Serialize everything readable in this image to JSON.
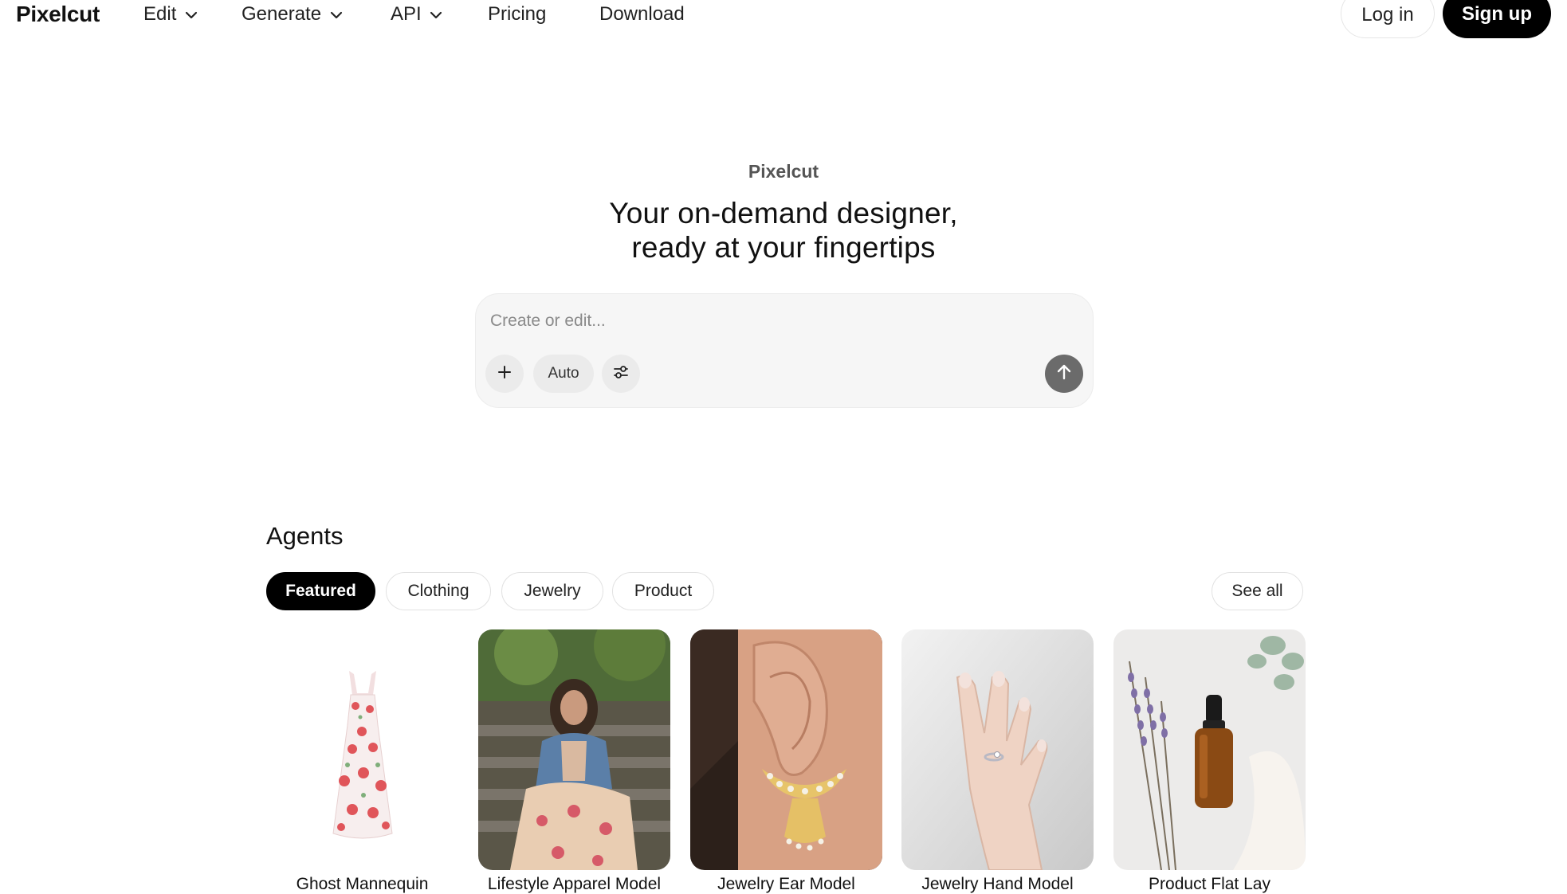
{
  "nav": {
    "logo": "Pixelcut",
    "items": [
      {
        "label": "Edit",
        "has_dropdown": true
      },
      {
        "label": "Generate",
        "has_dropdown": true
      },
      {
        "label": "API",
        "has_dropdown": true
      },
      {
        "label": "Pricing",
        "has_dropdown": false
      },
      {
        "label": "Download",
        "has_dropdown": false
      }
    ],
    "login_label": "Log in",
    "signup_label": "Sign up"
  },
  "hero": {
    "kicker": "Pixelcut",
    "title_line1": "Your on-demand designer,",
    "title_line2": "ready at your fingertips"
  },
  "prompt": {
    "placeholder": "Create or edit...",
    "value": "",
    "mode_label": "Auto",
    "icons": [
      "plus-icon",
      "sliders-icon",
      "arrow-up-icon"
    ]
  },
  "agents": {
    "title": "Agents",
    "filters": [
      {
        "label": "Featured",
        "active": true
      },
      {
        "label": "Clothing",
        "active": false
      },
      {
        "label": "Jewelry",
        "active": false
      },
      {
        "label": "Product",
        "active": false
      }
    ],
    "see_all_label": "See all",
    "cards": [
      {
        "label": "Ghost Mannequin",
        "image": "floral-dress"
      },
      {
        "label": "Lifestyle Apparel Model",
        "image": "woman-on-stairs"
      },
      {
        "label": "Jewelry Ear Model",
        "image": "ear-with-earring"
      },
      {
        "label": "Jewelry Hand Model",
        "image": "hand-with-ring"
      },
      {
        "label": "Product Flat Lay",
        "image": "serum-bottle-lavender"
      }
    ]
  },
  "colors": {
    "primary": "#000000",
    "prompt_bg": "#f6f6f6",
    "send_button": "#6b6b6b"
  }
}
